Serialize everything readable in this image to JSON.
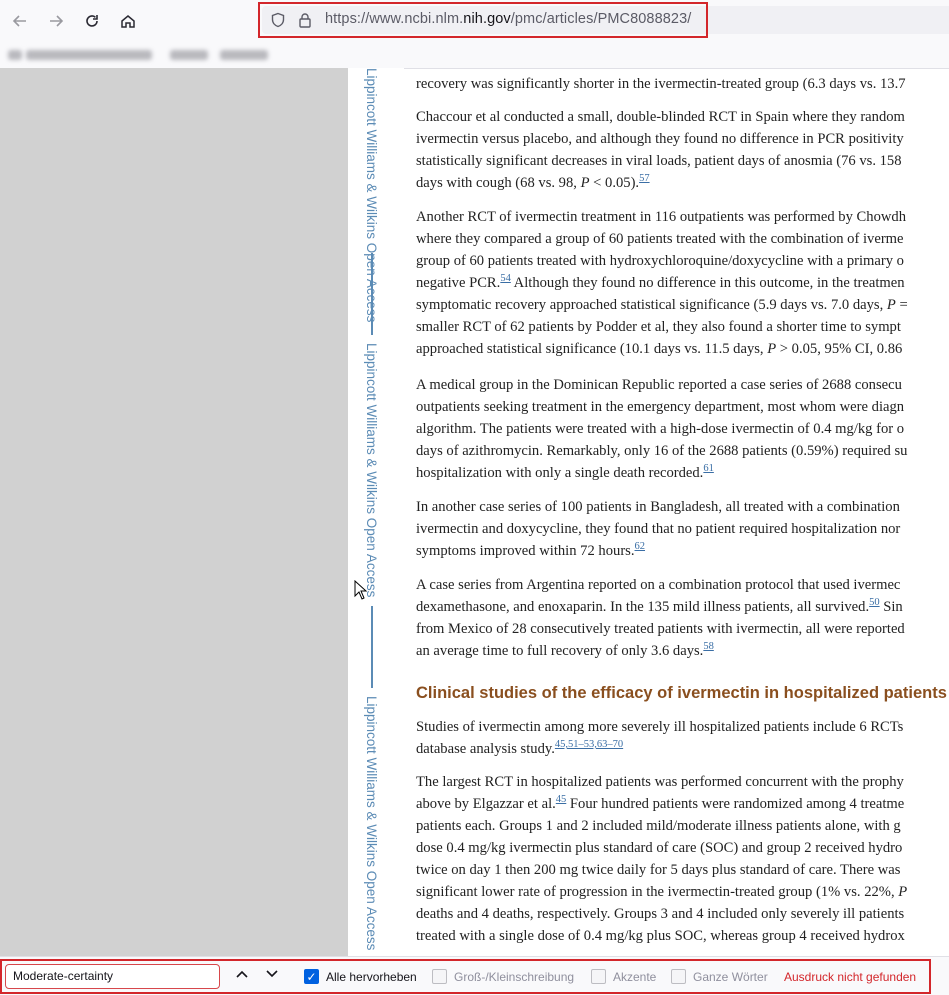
{
  "browser": {
    "url_prefix": "https://www.ncbi.nlm.",
    "url_host": "nih.gov",
    "url_suffix": "/pmc/articles/PMC8088823/",
    "icons": [
      "back-arrow-icon",
      "forward-arrow-icon",
      "reload-icon",
      "home-icon",
      "shield-icon",
      "lock-icon"
    ]
  },
  "sidebar": {
    "banner_top": "Lippincott Williams & Wilkins Open Access",
    "banner_mid": "Lippincott Williams & Wilkins Open Access",
    "banner_bottom": "Lippincott Williams & Wilkins Open Access",
    "banner_color": "#5b8bb5"
  },
  "article": {
    "p0_l1": "recovery was significantly shorter in the ivermectin-treated group (6.3 days vs. 13.7",
    "p1_l1": "Chaccour et al conducted a small, double-blinded RCT in Spain where they random",
    "p1_l2": "ivermectin versus placebo, and although they found no difference in PCR positivity",
    "p1_l3": "statistically significant decreases in viral loads, patient days of anosmia (76 vs. 158",
    "p1_l4_a": "days with cough (68 vs. 98, ",
    "p1_l4_p": "P",
    "p1_l4_b": " < 0.05).",
    "p1_ref": "57",
    "p2_l1": "Another RCT of ivermectin treatment in 116 outpatients was performed by Chowdh",
    "p2_l2": "where they compared a group of 60 patients treated with the combination of iverme",
    "p2_l3": "group of 60 patients treated with hydroxychloroquine/doxycycline with a primary o",
    "p2_l4_a": "negative PCR.",
    "p2_ref": "54",
    "p2_l4_b": " Although they found no difference in this outcome, in the treatmen",
    "p2_l5_a": "symptomatic recovery approached statistical significance (5.9 days vs. 7.0 days, ",
    "p2_l5_p": "P",
    "p2_l5_b": " =",
    "p2_l6": "smaller RCT of 62 patients by Podder et al, they also found a shorter time to sympt",
    "p2_l7_a": "approached statistical significance (10.1 days vs. 11.5 days, ",
    "p2_l7_p": "P",
    "p2_l7_b": " > 0.05, 95% CI, 0.86",
    "p3_l1": "A medical group in the Dominican Republic reported a case series of 2688 consecu",
    "p3_l2": "outpatients seeking treatment in the emergency department, most whom were diagn",
    "p3_l3": "algorithm. The patients were treated with a high-dose ivermectin of 0.4 mg/kg for o",
    "p3_l4": "days of azithromycin. Remarkably, only 16 of the 2688 patients (0.59%) required su",
    "p3_l5": "hospitalization with only a single death recorded.",
    "p3_ref": "61",
    "p4_l1": "In another case series of 100 patients in Bangladesh, all treated with a combination",
    "p4_l2": "ivermectin and doxycycline, they found that no patient required hospitalization nor",
    "p4_l3": "symptoms improved within 72 hours.",
    "p4_ref": "62",
    "p5_l1": "A case series from Argentina reported on a combination protocol that used ivermec",
    "p5_l2_a": "dexamethasone, and enoxaparin. In the 135 mild illness patients, all survived.",
    "p5_ref_a": "50",
    "p5_l2_b": " Sin",
    "p5_l3": "from Mexico of 28 consecutively treated patients with ivermectin, all were reported",
    "p5_l4": "an average time to full recovery of only 3.6 days.",
    "p5_ref_b": "58",
    "heading": "Clinical studies of the efficacy of ivermectin in hospitalized patients",
    "p6_l1": "Studies of ivermectin among more severely ill hospitalized patients include 6 RCTs",
    "p6_l2": "database analysis study.",
    "p6_refs": "45,51–53,63–70",
    "p7_l1": "The largest RCT in hospitalized patients was performed concurrent with the prophy",
    "p7_l2_a": "above by Elgazzar et al.",
    "p7_ref": "45",
    "p7_l2_b": " Four hundred patients were randomized among 4 treatme",
    "p7_l3": "patients each. Groups 1 and 2 included mild/moderate illness patients alone, with g",
    "p7_l4": "dose 0.4 mg/kg ivermectin plus standard of care (SOC) and group 2 received hydro",
    "p7_l5": "twice on day 1 then 200 mg twice daily for 5 days plus standard of care. There was",
    "p7_l6_a": "significant lower rate of progression in the ivermectin-treated group (1% vs. 22%, ",
    "p7_l6_p": "P",
    "p7_l7": "deaths and 4 deaths, respectively. Groups 3 and 4 included only severely ill patients",
    "p7_l8": "treated with a single dose of 0.4 mg/kg plus SOC, whereas group 4 received hydrox"
  },
  "findbar": {
    "query": "Moderate-certainty",
    "highlight_all": "Alle hervorheben",
    "match_case": "Groß-/Kleinschreibung",
    "diacritics": "Akzente",
    "whole_words": "Ganze Wörter",
    "status": "Ausdruck nicht gefunden",
    "status_color": "#d3262b",
    "highlight_all_checked": true
  }
}
